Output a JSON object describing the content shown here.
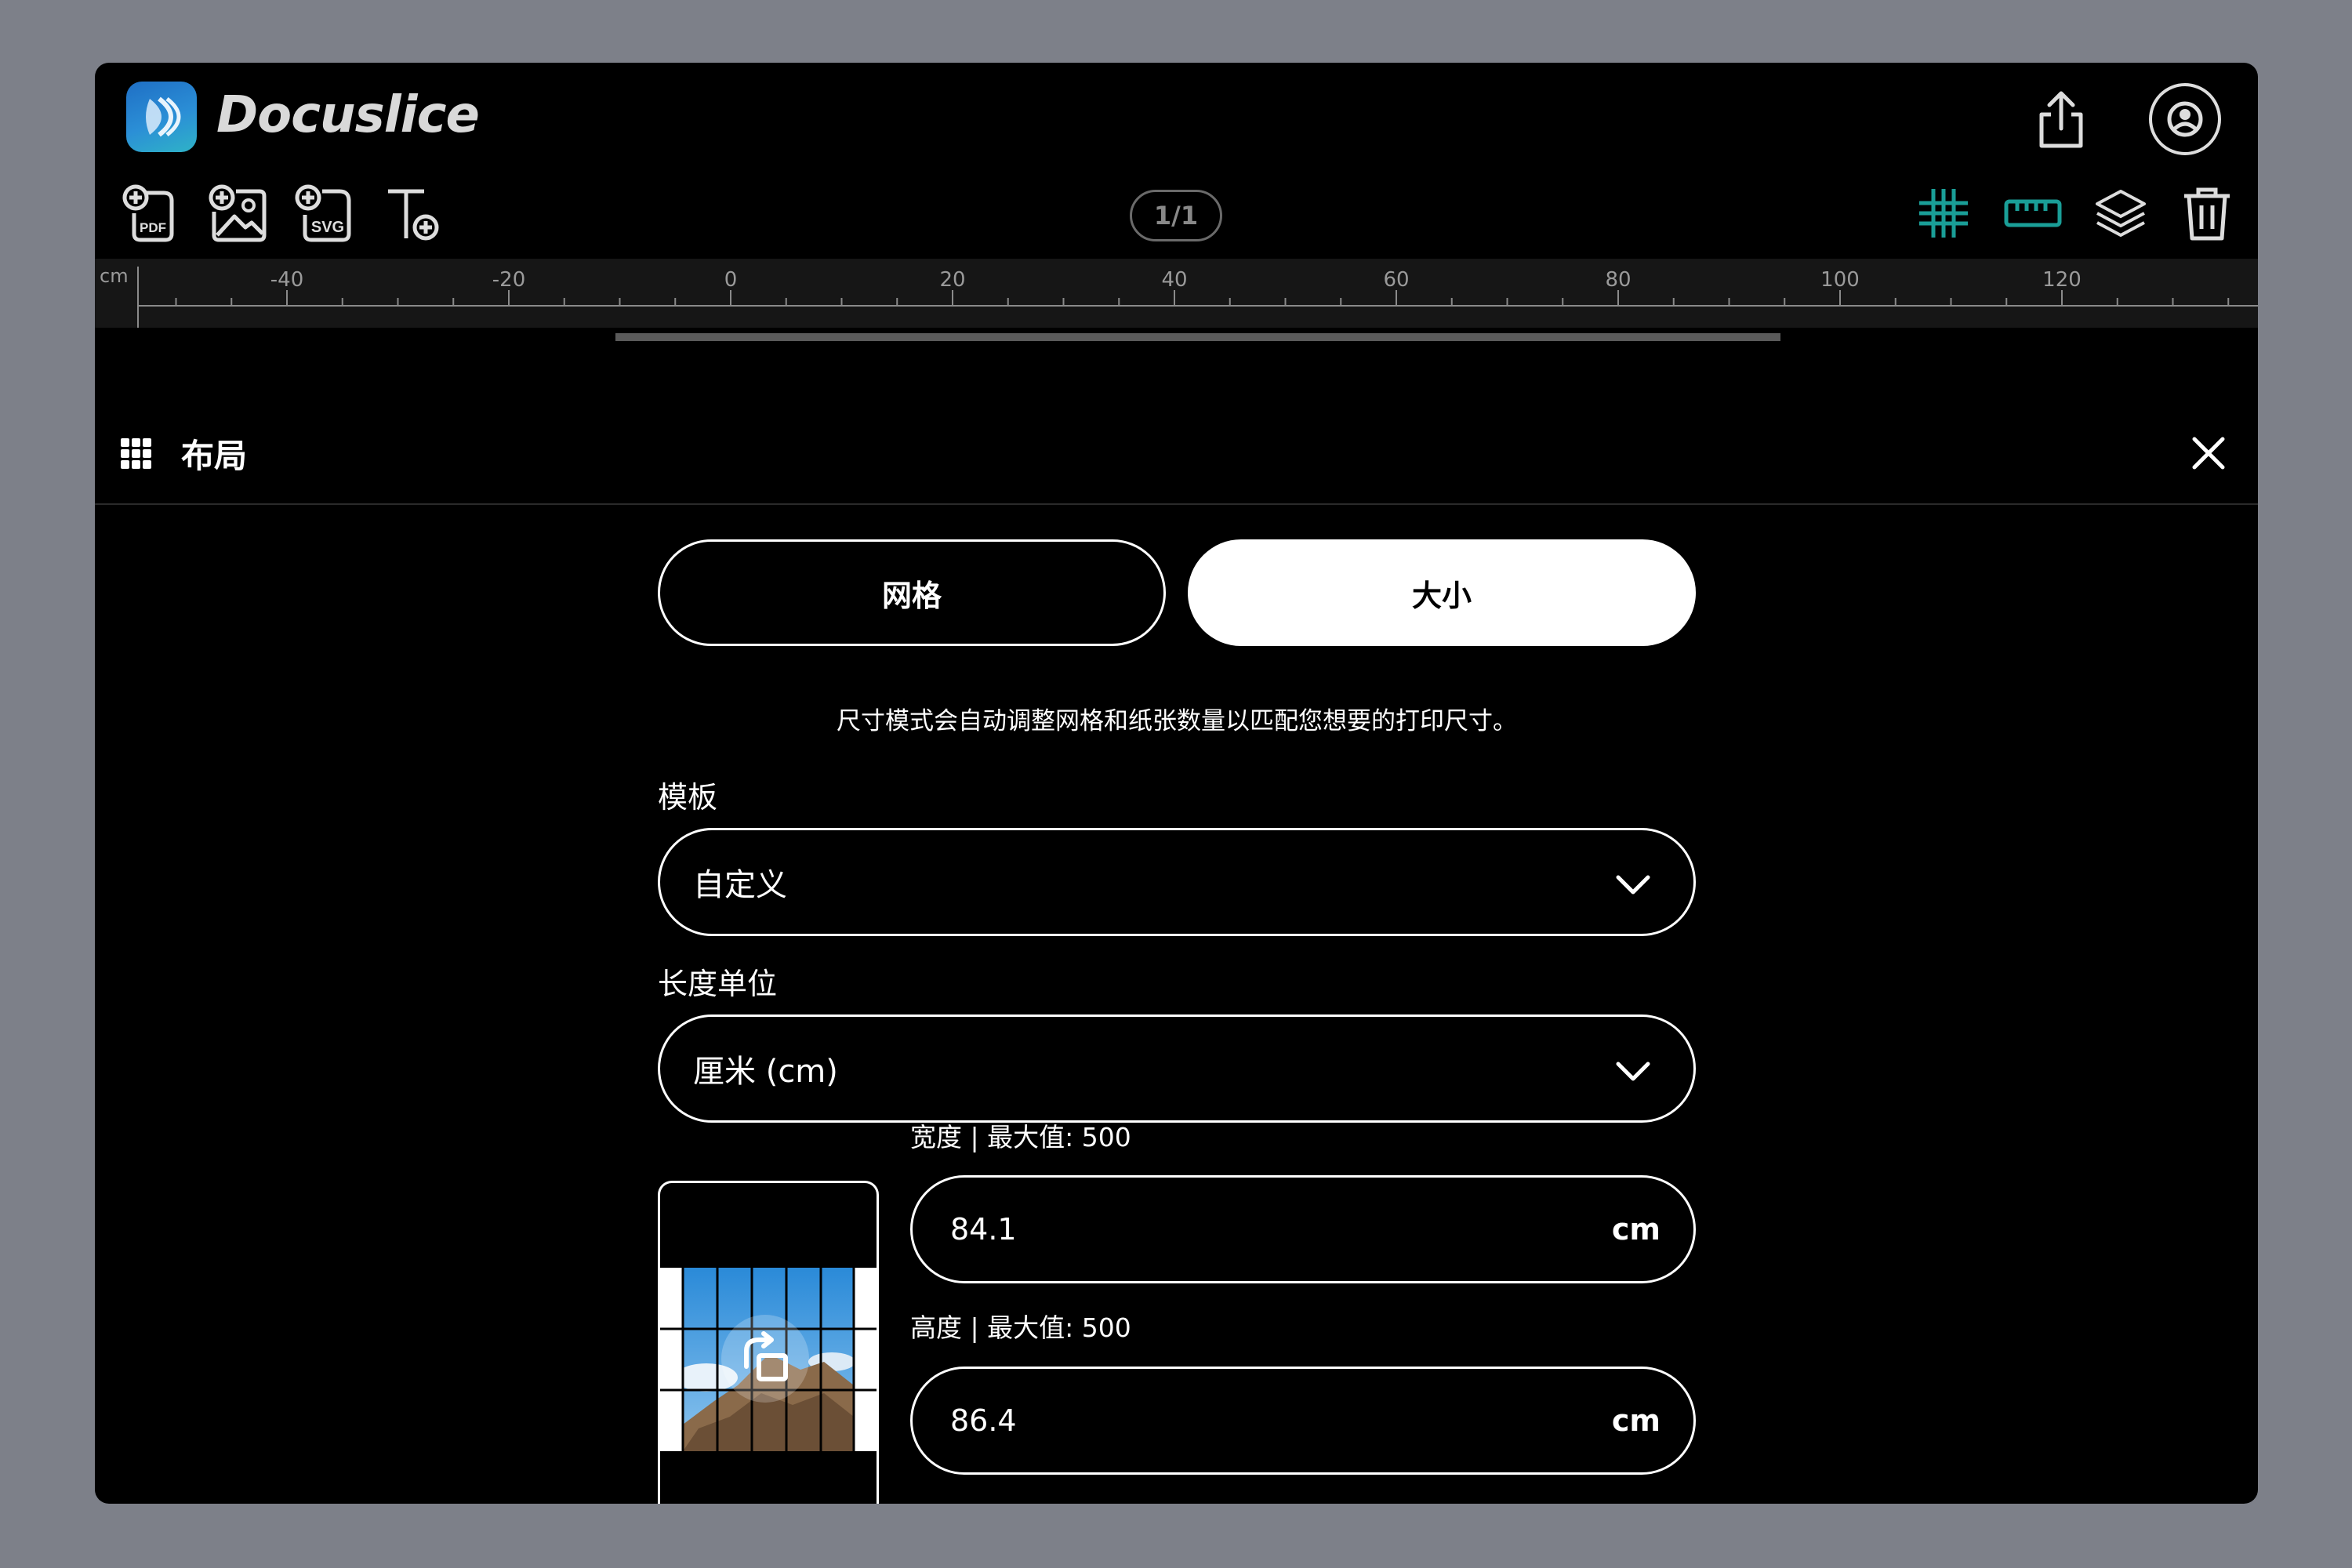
{
  "app": {
    "name": "Docuslice",
    "accent_color": "#1a9e97"
  },
  "header": {
    "share_icon": "share-icon",
    "account_icon": "account-icon"
  },
  "toolbar": {
    "page_indicator": "1/1",
    "add_pdf_badge": "PDF",
    "add_svg_badge": "SVG"
  },
  "ruler": {
    "unit": "cm",
    "ticks": [
      "-40",
      "-20",
      "0",
      "20",
      "40",
      "60",
      "80",
      "100",
      "120"
    ]
  },
  "panel": {
    "title": "布局",
    "tabs": [
      {
        "label": "网格",
        "active": false
      },
      {
        "label": "大小",
        "active": true
      }
    ],
    "description": "尺寸模式会自动调整网格和纸张数量以匹配您想要的打印尺寸。",
    "template": {
      "label": "模板",
      "value": "自定义"
    },
    "length_unit": {
      "label": "长度单位",
      "value": "厘米 (cm)"
    },
    "width": {
      "label": "宽度 | 最大值: 500",
      "value": "84.1",
      "unit": "cm"
    },
    "height": {
      "label": "高度 | 最大值: 500",
      "value": "86.4",
      "unit": "cm"
    }
  }
}
